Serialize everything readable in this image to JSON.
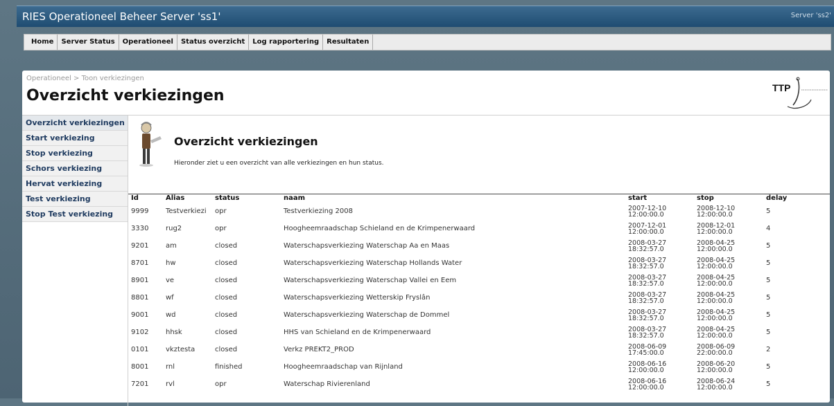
{
  "app": {
    "title": "RIES Operationeel Beheer Server 'ss1'",
    "server_label": "Server 'ss2'"
  },
  "nav": {
    "items": [
      "Home",
      "Server Status",
      "Operationeel",
      "Status overzicht",
      "Log rapportering",
      "Resultaten"
    ]
  },
  "page": {
    "breadcrumb": "Operationeel > Toon verkiezingen",
    "title": "Overzicht verkiezingen",
    "logo_text": "TTP"
  },
  "sidebar": {
    "items": [
      "Overzicht verkiezingen",
      "Start verkiezing",
      "Stop verkiezing",
      "Schors verkiezing",
      "Hervat verkiezing",
      "Test verkiezing",
      "Stop Test verkiezing"
    ]
  },
  "content": {
    "title": "Overzicht verkiezingen",
    "description": "Hieronder ziet u een overzicht van alle verkiezingen en hun status."
  },
  "table": {
    "headers": [
      "Id",
      "Alias",
      "status",
      "naam",
      "start",
      "stop",
      "delay"
    ],
    "rows": [
      {
        "id": "9999",
        "alias": "Testverkiezi",
        "status": "opr",
        "naam": "Testverkiezing 2008",
        "start_date": "2007-12-10",
        "start_time": "12:00:00.0",
        "stop_date": "2008-12-10",
        "stop_time": "12:00:00.0",
        "delay": "5"
      },
      {
        "id": "3330",
        "alias": "rug2",
        "status": "opr",
        "naam": "Hoogheemraadschap Schieland en de Krimpenerwaard",
        "start_date": "2007-12-01",
        "start_time": "12:00:00.0",
        "stop_date": "2008-12-01",
        "stop_time": "12:00:00.0",
        "delay": "4"
      },
      {
        "id": "9201",
        "alias": "am",
        "status": "closed",
        "naam": "Waterschapsverkiezing Waterschap Aa en Maas",
        "start_date": "2008-03-27",
        "start_time": "18:32:57.0",
        "stop_date": "2008-04-25",
        "stop_time": "12:00:00.0",
        "delay": "5"
      },
      {
        "id": "8701",
        "alias": "hw",
        "status": "closed",
        "naam": "Waterschapsverkiezing Waterschap Hollands Water",
        "start_date": "2008-03-27",
        "start_time": "18:32:57.0",
        "stop_date": "2008-04-25",
        "stop_time": "12:00:00.0",
        "delay": "5"
      },
      {
        "id": "8901",
        "alias": "ve",
        "status": "closed",
        "naam": "Waterschapsverkiezing Waterschap Vallei en Eem",
        "start_date": "2008-03-27",
        "start_time": "18:32:57.0",
        "stop_date": "2008-04-25",
        "stop_time": "12:00:00.0",
        "delay": "5"
      },
      {
        "id": "8801",
        "alias": "wf",
        "status": "closed",
        "naam": "Waterschapsverkiezing Wetterskip Fryslân",
        "start_date": "2008-03-27",
        "start_time": "18:32:57.0",
        "stop_date": "2008-04-25",
        "stop_time": "12:00:00.0",
        "delay": "5"
      },
      {
        "id": "9001",
        "alias": "wd",
        "status": "closed",
        "naam": "Waterschapsverkiezing Waterschap de Dommel",
        "start_date": "2008-03-27",
        "start_time": "18:32:57.0",
        "stop_date": "2008-04-25",
        "stop_time": "12:00:00.0",
        "delay": "5"
      },
      {
        "id": "9102",
        "alias": "hhsk",
        "status": "closed",
        "naam": "HHS van Schieland en de Krimpenerwaard",
        "start_date": "2008-03-27",
        "start_time": "18:32:57.0",
        "stop_date": "2008-04-25",
        "stop_time": "12:00:00.0",
        "delay": "5"
      },
      {
        "id": "0101",
        "alias": "vkztesta",
        "status": "closed",
        "naam": "Verkz PREKT2_PROD",
        "start_date": "2008-06-09",
        "start_time": "17:45:00.0",
        "stop_date": "2008-06-09",
        "stop_time": "22:00:00.0",
        "delay": "2"
      },
      {
        "id": "8001",
        "alias": "rnl",
        "status": "finished",
        "naam": "Hoogheemraadschap van Rijnland",
        "start_date": "2008-06-16",
        "start_time": "12:00:00.0",
        "stop_date": "2008-06-20",
        "stop_time": "12:00:00.0",
        "delay": "5"
      },
      {
        "id": "7201",
        "alias": "rvl",
        "status": "opr",
        "naam": "Waterschap Rivierenland",
        "start_date": "2008-06-16",
        "start_time": "12:00:00.0",
        "stop_date": "2008-06-24",
        "stop_time": "12:00:00.0",
        "delay": "5"
      }
    ]
  },
  "colors": {
    "header_bar": "#2d5b80",
    "background": "#5e7583",
    "sidebar_text": "#1e3a5f"
  }
}
